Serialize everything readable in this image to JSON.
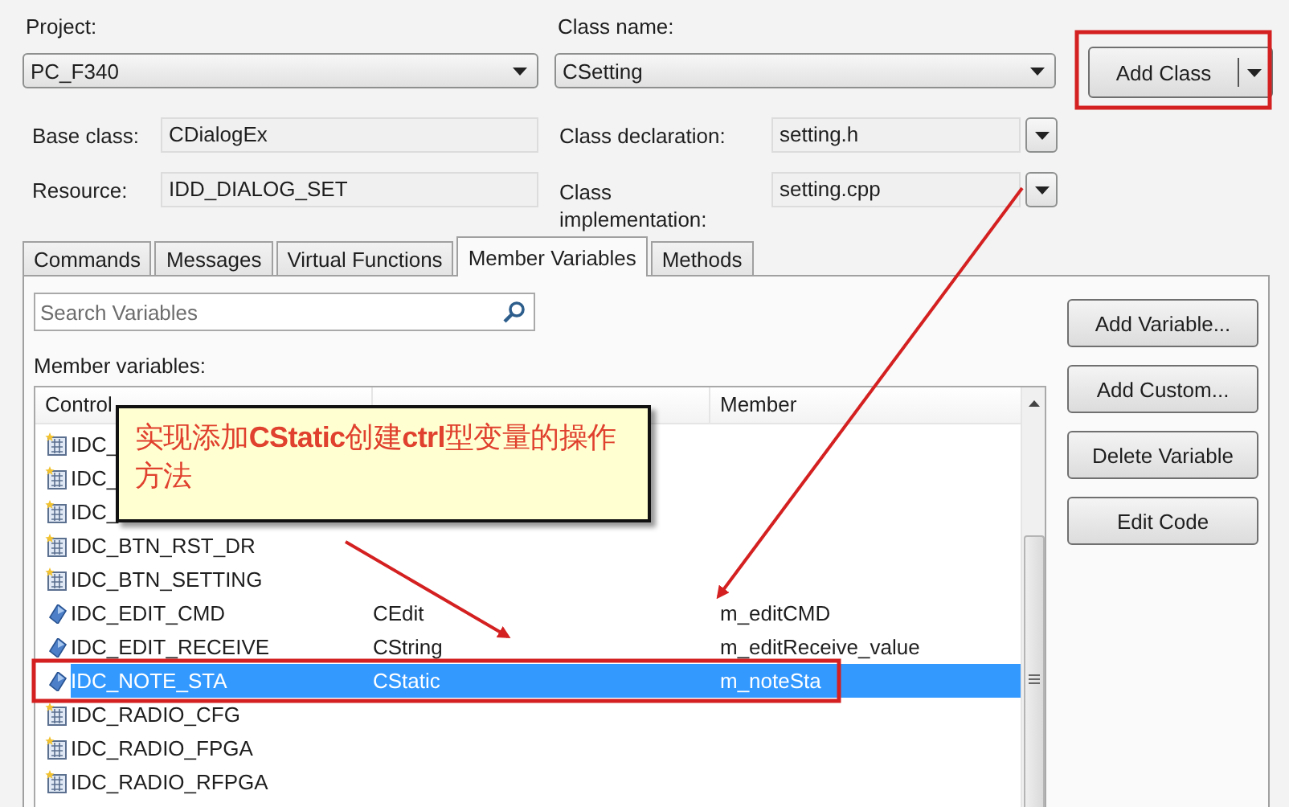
{
  "project": {
    "label": "Project:",
    "value": "PC_F340"
  },
  "class_name": {
    "label": "Class name:",
    "value": "CSetting"
  },
  "add_class_button": {
    "label": "Add Class"
  },
  "base_class": {
    "label": "Base class:",
    "value": "CDialogEx"
  },
  "resource": {
    "label": "Resource:",
    "value": "IDD_DIALOG_SET"
  },
  "class_declaration": {
    "label": "Class declaration:",
    "value": "setting.h"
  },
  "class_implementation": {
    "label": "Class implementation:",
    "value": "setting.cpp"
  },
  "tabs": [
    {
      "label": "Commands",
      "selected": false
    },
    {
      "label": "Messages",
      "selected": false
    },
    {
      "label": "Virtual Functions",
      "selected": false
    },
    {
      "label": "Member Variables",
      "selected": true
    },
    {
      "label": "Methods",
      "selected": false
    }
  ],
  "search": {
    "placeholder": "Search Variables"
  },
  "list_label": "Member variables:",
  "table": {
    "header": {
      "control_id": "Control",
      "member": "Member"
    },
    "rows": [
      {
        "kind": "control",
        "id": "IDC_",
        "selected": false
      },
      {
        "kind": "control",
        "id": "IDC_",
        "selected": false
      },
      {
        "kind": "control",
        "id": "IDC_",
        "selected": false
      },
      {
        "kind": "control",
        "id": "IDC_BTN_RST_DR",
        "selected": false
      },
      {
        "kind": "control",
        "id": "IDC_BTN_SETTING",
        "selected": false
      },
      {
        "kind": "variable",
        "id": "IDC_EDIT_CMD",
        "type": "CEdit",
        "member": "m_editCMD",
        "selected": false
      },
      {
        "kind": "variable",
        "id": "IDC_EDIT_RECEIVE",
        "type": "CString",
        "member": "m_editReceive_value",
        "selected": false
      },
      {
        "kind": "variable",
        "id": "IDC_NOTE_STA",
        "type": "CStatic",
        "member": "m_noteSta",
        "selected": true
      },
      {
        "kind": "control",
        "id": "IDC_RADIO_CFG",
        "selected": false
      },
      {
        "kind": "control",
        "id": "IDC_RADIO_FPGA",
        "selected": false
      },
      {
        "kind": "control",
        "id": "IDC_RADIO_RFPGA",
        "selected": false
      }
    ]
  },
  "buttons": [
    "Add Variable...",
    "Add Custom...",
    "Delete Variable",
    "Edit Code"
  ],
  "callout": {
    "text": "实现添加**CStatic**创建**ctrl**型变量的操作方法"
  }
}
